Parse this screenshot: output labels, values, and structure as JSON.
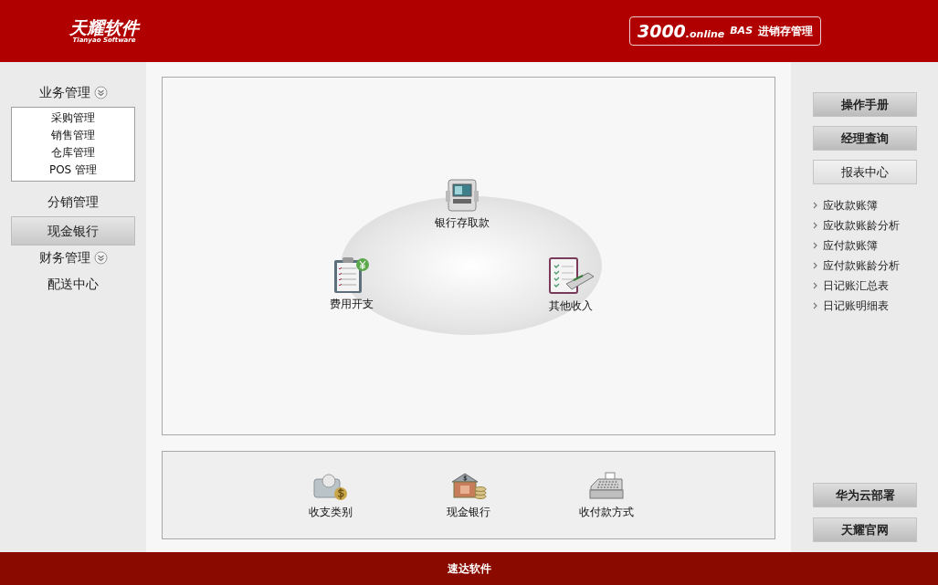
{
  "header": {
    "logo": "天耀软件",
    "logo_subtitle": "Tianyao Software",
    "product": {
      "version": "3000",
      ".online": ".online",
      "edition": "BAS",
      "name": "进销存管理"
    }
  },
  "left_nav": [
    {
      "kind": "group",
      "label": "业务管理",
      "children": [
        "采购管理",
        "销售管理",
        "仓库管理",
        "POS 管理"
      ]
    },
    {
      "kind": "link",
      "label": "分销管理",
      "selected": false
    },
    {
      "kind": "link",
      "label": "现金银行",
      "selected": true
    },
    {
      "kind": "group",
      "label": "财务管理"
    },
    {
      "kind": "link",
      "label": "配送中心",
      "selected": false
    }
  ],
  "diagram": {
    "nodes": [
      {
        "label": "银行存取款"
      },
      {
        "label": "费用开支"
      },
      {
        "label": "其他收入"
      }
    ]
  },
  "settings": [
    {
      "label": "收支类别"
    },
    {
      "label": "现金银行"
    },
    {
      "label": "收付款方式"
    }
  ],
  "right_buttons": [
    {
      "label": "操作手册",
      "selected": false
    },
    {
      "label": "经理查询",
      "selected": false
    },
    {
      "label": "报表中心",
      "selected": true
    }
  ],
  "reports": [
    "应收款账簿",
    "应收款账龄分析",
    "应付款账簿",
    "应付款账龄分析",
    "日记账汇总表",
    "日记账明细表"
  ],
  "bottom_buttons": [
    "华为云部署",
    "天耀官网"
  ],
  "footer": "速达软件"
}
